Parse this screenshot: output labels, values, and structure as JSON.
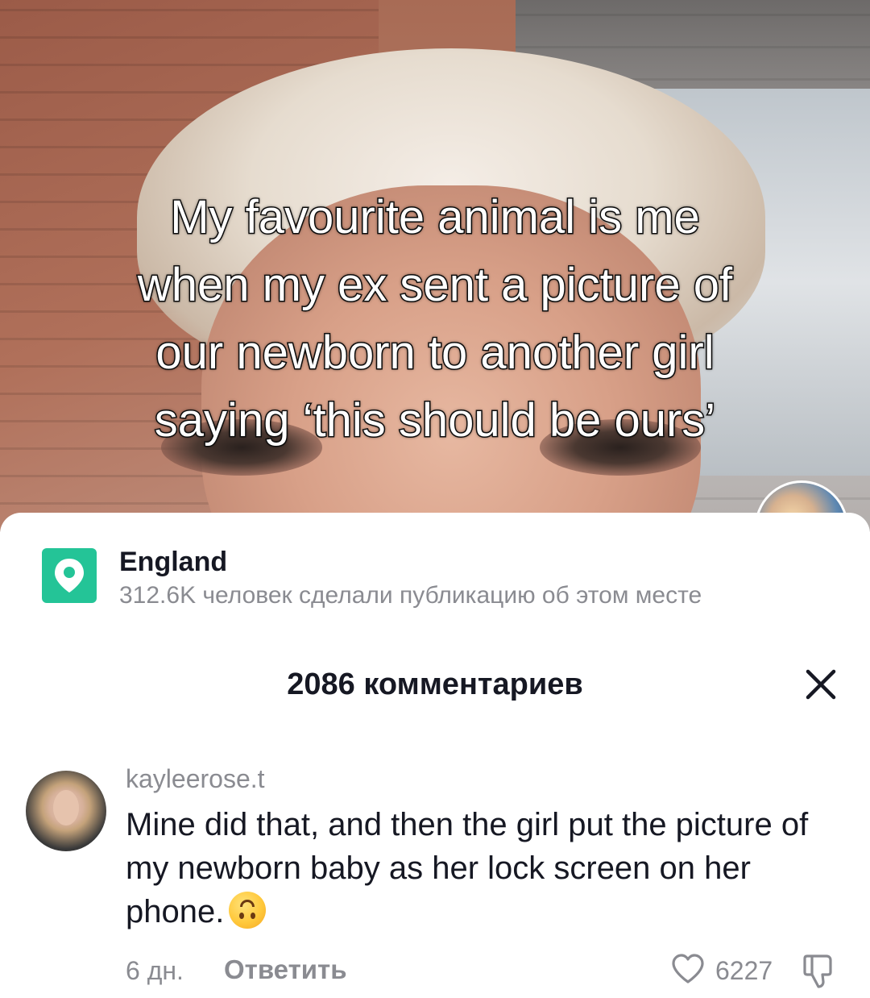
{
  "video": {
    "overlay_lines": [
      "My favourite animal is me",
      "when my ex sent a picture of",
      "our newborn to another girl",
      "saying ‘this should be ours’"
    ]
  },
  "location": {
    "icon": "map-pin-icon",
    "accent_color": "#24c497",
    "title": "England",
    "subtitle": "312.6K человек сделали публикацию об этом месте"
  },
  "comments": {
    "header": "2086 комментариев",
    "close_icon": "close-icon",
    "items": [
      {
        "username": "kayleerose.t",
        "text": "Mine did that, and then the girl put the picture of my newborn baby as her lock screen on her phone.",
        "emoji": "upside-down-face-emoji",
        "time": "6 дн.",
        "reply_label": "Ответить",
        "like_icon": "heart-outline-icon",
        "likes": "6227",
        "dislike_icon": "thumbs-down-icon"
      }
    ]
  }
}
